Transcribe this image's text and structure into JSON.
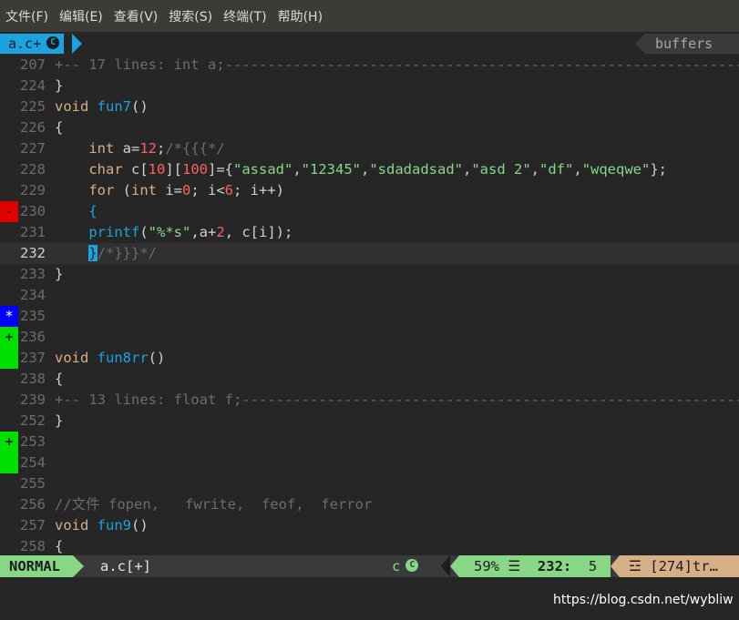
{
  "menubar": {
    "items": [
      "文件(F)",
      "编辑(E)",
      "查看(V)",
      "搜索(S)",
      "终端(T)",
      "帮助(H)"
    ]
  },
  "tabline": {
    "active_tab": "a.c+",
    "active_tab_icon": "c-language-icon",
    "buffers_label": "buffers"
  },
  "editor": {
    "lines": [
      {
        "num": "207",
        "sign": "",
        "segments": [
          {
            "t": "fold",
            "v": "+-- 17 lines: int a;-------------------------------------------------------------"
          }
        ]
      },
      {
        "num": "224",
        "sign": "",
        "segments": [
          {
            "t": "p",
            "v": "}"
          }
        ]
      },
      {
        "num": "225",
        "sign": "",
        "segments": [
          {
            "t": "kw",
            "v": "void"
          },
          {
            "t": "p",
            "v": " "
          },
          {
            "t": "fn",
            "v": "fun7"
          },
          {
            "t": "p",
            "v": "()"
          }
        ]
      },
      {
        "num": "226",
        "sign": "",
        "segments": [
          {
            "t": "p",
            "v": "{"
          }
        ]
      },
      {
        "num": "227",
        "sign": "",
        "segments": [
          {
            "t": "p",
            "v": "    "
          },
          {
            "t": "kw",
            "v": "int"
          },
          {
            "t": "p",
            "v": " a="
          },
          {
            "t": "num",
            "v": "12"
          },
          {
            "t": "p",
            "v": ";"
          },
          {
            "t": "cm",
            "v": "/*{{{*/"
          }
        ]
      },
      {
        "num": "228",
        "sign": "",
        "segments": [
          {
            "t": "p",
            "v": "    "
          },
          {
            "t": "kw",
            "v": "char"
          },
          {
            "t": "p",
            "v": " c["
          },
          {
            "t": "num",
            "v": "10"
          },
          {
            "t": "p",
            "v": "]["
          },
          {
            "t": "num",
            "v": "100"
          },
          {
            "t": "p",
            "v": "]={"
          },
          {
            "t": "str",
            "v": "\"assad\""
          },
          {
            "t": "p",
            "v": ","
          },
          {
            "t": "str",
            "v": "\"12345\""
          },
          {
            "t": "p",
            "v": ","
          },
          {
            "t": "str",
            "v": "\"sdadadsad\""
          },
          {
            "t": "p",
            "v": ","
          },
          {
            "t": "str",
            "v": "\"asd 2\""
          },
          {
            "t": "p",
            "v": ","
          },
          {
            "t": "str",
            "v": "\"df\""
          },
          {
            "t": "p",
            "v": ","
          },
          {
            "t": "str",
            "v": "\"wqeqwe\""
          },
          {
            "t": "p",
            "v": "};"
          }
        ]
      },
      {
        "num": "229",
        "sign": "",
        "segments": [
          {
            "t": "p",
            "v": "    "
          },
          {
            "t": "kw",
            "v": "for"
          },
          {
            "t": "p",
            "v": " ("
          },
          {
            "t": "kw",
            "v": "int"
          },
          {
            "t": "p",
            "v": " i="
          },
          {
            "t": "num",
            "v": "0"
          },
          {
            "t": "p",
            "v": "; i<"
          },
          {
            "t": "num",
            "v": "6"
          },
          {
            "t": "p",
            "v": "; i++)"
          }
        ]
      },
      {
        "num": "230",
        "sign": "-",
        "signClass": "del",
        "segments": [
          {
            "t": "p",
            "v": "    "
          },
          {
            "t": "br",
            "v": "{"
          }
        ]
      },
      {
        "num": "231",
        "sign": "",
        "segments": [
          {
            "t": "p",
            "v": "    "
          },
          {
            "t": "fn",
            "v": "printf"
          },
          {
            "t": "p",
            "v": "("
          },
          {
            "t": "str",
            "v": "\"%*s\""
          },
          {
            "t": "p",
            "v": ",a+"
          },
          {
            "t": "num",
            "v": "2"
          },
          {
            "t": "p",
            "v": ", c[i]);"
          }
        ]
      },
      {
        "num": "232",
        "sign": "",
        "current": true,
        "segments": [
          {
            "t": "p",
            "v": "    "
          },
          {
            "t": "cursor",
            "v": "}"
          },
          {
            "t": "cm",
            "v": "/*}}}*/"
          }
        ]
      },
      {
        "num": "233",
        "sign": "",
        "segments": [
          {
            "t": "p",
            "v": "}"
          }
        ]
      },
      {
        "num": "234",
        "sign": "",
        "segments": []
      },
      {
        "num": "235",
        "sign": "*",
        "signClass": "mod",
        "segments": []
      },
      {
        "num": "236",
        "sign": "+",
        "signClass": "add",
        "segments": []
      },
      {
        "num": "237",
        "sign": " ",
        "signClass": "add",
        "segments": [
          {
            "t": "kw",
            "v": "void"
          },
          {
            "t": "p",
            "v": " "
          },
          {
            "t": "fn",
            "v": "fun8rr"
          },
          {
            "t": "p",
            "v": "()"
          }
        ]
      },
      {
        "num": "238",
        "sign": "",
        "segments": [
          {
            "t": "p",
            "v": "{"
          }
        ]
      },
      {
        "num": "239",
        "sign": "",
        "segments": [
          {
            "t": "fold",
            "v": "+-- 13 lines: float f;-----------------------------------------------------------"
          }
        ]
      },
      {
        "num": "252",
        "sign": "",
        "segments": [
          {
            "t": "p",
            "v": "}"
          }
        ]
      },
      {
        "num": "253",
        "sign": "+",
        "signClass": "add",
        "segments": []
      },
      {
        "num": "254",
        "sign": " ",
        "signClass": "add",
        "segments": []
      },
      {
        "num": "255",
        "sign": "",
        "segments": []
      },
      {
        "num": "256",
        "sign": "",
        "segments": [
          {
            "t": "cm",
            "v": "//文件 fopen,   fwrite,  feof,  ferror"
          }
        ]
      },
      {
        "num": "257",
        "sign": "",
        "segments": [
          {
            "t": "kw",
            "v": "void"
          },
          {
            "t": "p",
            "v": " "
          },
          {
            "t": "fn",
            "v": "fun9"
          },
          {
            "t": "p",
            "v": "()"
          }
        ]
      },
      {
        "num": "258",
        "sign": "",
        "segments": [
          {
            "t": "p",
            "v": "{"
          }
        ]
      }
    ]
  },
  "statusline": {
    "mode": "NORMAL",
    "filename": "a.c[+]",
    "filetype": "c",
    "filetype_icon": "c-language-icon",
    "percent": "59%",
    "lines_icon": "☰",
    "line": "232:",
    "col": "5",
    "trailing_icon": "☲",
    "trailing": "[274]tr…"
  },
  "watermark": "https://blog.csdn.net/wybliw"
}
